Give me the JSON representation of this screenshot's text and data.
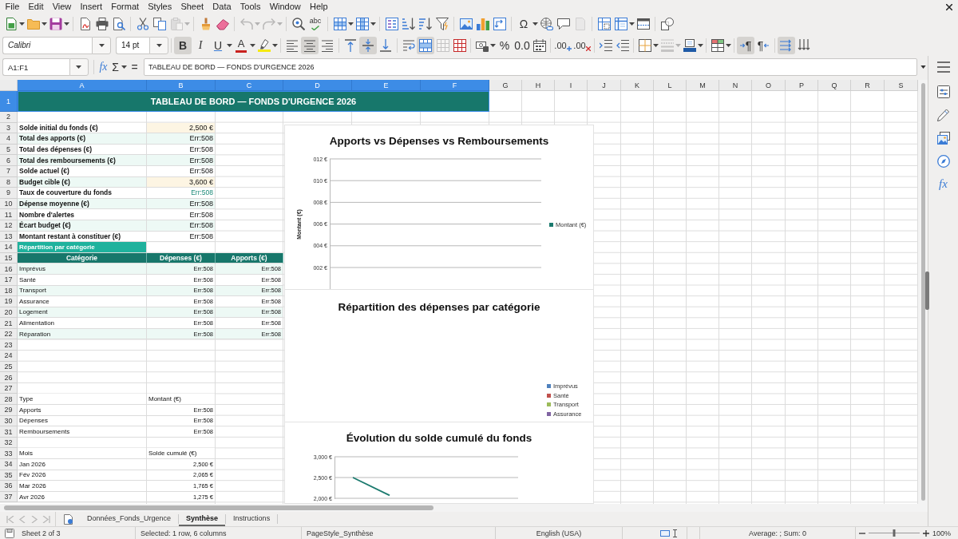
{
  "menu": [
    "File",
    "Edit",
    "View",
    "Insert",
    "Format",
    "Styles",
    "Sheet",
    "Data",
    "Tools",
    "Window",
    "Help"
  ],
  "standard_toolbar": {
    "paste_disabled": true,
    "undo_disabled": true,
    "redo_disabled": true,
    "header_footer_disabled": true,
    "spelling_glyph": "abc",
    "special_character_glyph": "Ω"
  },
  "formatting_toolbar": {
    "font_name": "Calibri",
    "font_size": "14 pt",
    "bold_glyph": "B",
    "bold": true,
    "italic_glyph": "I",
    "italic": false,
    "underline_glyph": "U",
    "underline": false,
    "font_color_glyph": "A",
    "align_left": false,
    "align_center": true,
    "align_right": false,
    "align_top": false,
    "align_middle": true,
    "align_bottom": false,
    "merge_and_center": true,
    "merge_disabled": true,
    "percent_glyph": "%",
    "number_glyph": "0.0",
    "add_decimal_glyph": ".00",
    "delete_decimal_glyph": ".00",
    "border_style_disabled": true,
    "paragraph_glyph_ltr": "¶",
    "paragraph_glyph_rtl": "¶",
    "left_to_right": true,
    "text_horizontal": true
  },
  "formula_bar": {
    "name_box": "A1:F1",
    "function_wizard_glyph": "fx",
    "sum_glyph": "Σ",
    "equals_glyph": "=",
    "content": "TABLEAU DE BORD — FONDS D'URGENCE 2026"
  },
  "sheet": {
    "columns": [
      {
        "label": "A",
        "selected": true
      },
      {
        "label": "B",
        "selected": true
      },
      {
        "label": "C",
        "selected": true
      },
      {
        "label": "D",
        "selected": true
      },
      {
        "label": "E",
        "selected": true
      },
      {
        "label": "F",
        "selected": true
      },
      {
        "label": "G",
        "selected": false
      },
      {
        "label": "H",
        "selected": false
      },
      {
        "label": "I",
        "selected": false
      },
      {
        "label": "J",
        "selected": false
      },
      {
        "label": "K",
        "selected": false
      },
      {
        "label": "L",
        "selected": false
      },
      {
        "label": "M",
        "selected": false
      },
      {
        "label": "N",
        "selected": false
      },
      {
        "label": "O",
        "selected": false
      },
      {
        "label": "P",
        "selected": false
      },
      {
        "label": "Q",
        "selected": false
      },
      {
        "label": "R",
        "selected": false
      },
      {
        "label": "S",
        "selected": false
      }
    ],
    "rows": [
      {
        "number": "1",
        "selected": true,
        "cells": [
          {
            "kind": "title",
            "text": "TABLEAU DE BORD — FONDS D'URGENCE 2026"
          }
        ]
      },
      {
        "number": "2",
        "selected": false
      },
      {
        "number": "3",
        "selected": false,
        "cells": [
          {
            "kind": "label",
            "text": "Solde initial du fonds (€)",
            "shaded": false
          },
          {
            "kind": "input",
            "text": "2,500 €"
          }
        ]
      },
      {
        "number": "4",
        "selected": false,
        "cells": [
          {
            "kind": "label",
            "text": "Total des apports (€)",
            "shaded": true
          },
          {
            "kind": "value",
            "text": "Err:508",
            "shaded": true
          }
        ]
      },
      {
        "number": "5",
        "selected": false,
        "cells": [
          {
            "kind": "label",
            "text": "Total des dépenses (€)",
            "shaded": false
          },
          {
            "kind": "value",
            "text": "Err:508",
            "shaded": false
          }
        ]
      },
      {
        "number": "6",
        "selected": false,
        "cells": [
          {
            "kind": "label",
            "text": "Total des remboursements (€)",
            "shaded": true
          },
          {
            "kind": "value",
            "text": "Err:508",
            "shaded": true
          }
        ]
      },
      {
        "number": "7",
        "selected": false,
        "cells": [
          {
            "kind": "label",
            "text": "Solde actuel (€)",
            "shaded": false
          },
          {
            "kind": "value",
            "text": "Err:508",
            "shaded": false
          }
        ]
      },
      {
        "number": "8",
        "selected": false,
        "cells": [
          {
            "kind": "label",
            "text": "Budget cible (€)",
            "shaded": true
          },
          {
            "kind": "input",
            "text": "3,600 €"
          }
        ]
      },
      {
        "number": "9",
        "selected": false,
        "cells": [
          {
            "kind": "label",
            "text": "Taux de couverture du fonds",
            "shaded": false
          },
          {
            "kind": "accent",
            "text": "Err:508",
            "shaded": false
          }
        ]
      },
      {
        "number": "10",
        "selected": false,
        "cells": [
          {
            "kind": "label",
            "text": "Dépense moyenne (€)",
            "shaded": true
          },
          {
            "kind": "value",
            "text": "Err:508",
            "shaded": true
          }
        ]
      },
      {
        "number": "11",
        "selected": false,
        "cells": [
          {
            "kind": "label",
            "text": "Nombre d'alertes",
            "shaded": false
          },
          {
            "kind": "value",
            "text": "Err:508",
            "shaded": false
          }
        ]
      },
      {
        "number": "12",
        "selected": false,
        "cells": [
          {
            "kind": "label",
            "text": "Écart budget (€)",
            "shaded": true
          },
          {
            "kind": "value",
            "text": "Err:508",
            "shaded": true
          }
        ]
      },
      {
        "number": "13",
        "selected": false,
        "cells": [
          {
            "kind": "label",
            "text": "Montant restant à constituer (€)",
            "shaded": false
          },
          {
            "kind": "value",
            "text": "Err:508",
            "shaded": false
          }
        ]
      },
      {
        "number": "14",
        "selected": false,
        "cells": [
          {
            "kind": "section",
            "text": "Répartition par catégorie"
          }
        ]
      },
      {
        "number": "15",
        "selected": false,
        "cells": [
          {
            "kind": "header",
            "text": "Catégorie"
          },
          {
            "kind": "header",
            "text": "Dépenses (€)"
          },
          {
            "kind": "header",
            "text": "Apports (€)"
          }
        ]
      },
      {
        "number": "16",
        "selected": false,
        "cells": [
          {
            "kind": "text",
            "text": "Imprévus",
            "shaded": true
          },
          {
            "kind": "number",
            "text": "Err:508",
            "shaded": true
          },
          {
            "kind": "number",
            "text": "Err:508",
            "shaded": true
          }
        ]
      },
      {
        "number": "17",
        "selected": false,
        "cells": [
          {
            "kind": "text",
            "text": "Santé",
            "shaded": false
          },
          {
            "kind": "number",
            "text": "Err:508",
            "shaded": false
          },
          {
            "kind": "number",
            "text": "Err:508",
            "shaded": false
          }
        ]
      },
      {
        "number": "18",
        "selected": false,
        "cells": [
          {
            "kind": "text",
            "text": "Transport",
            "shaded": true
          },
          {
            "kind": "number",
            "text": "Err:508",
            "shaded": true
          },
          {
            "kind": "number",
            "text": "Err:508",
            "shaded": true
          }
        ]
      },
      {
        "number": "19",
        "selected": false,
        "cells": [
          {
            "kind": "text",
            "text": "Assurance",
            "shaded": false
          },
          {
            "kind": "number",
            "text": "Err:508",
            "shaded": false
          },
          {
            "kind": "number",
            "text": "Err:508",
            "shaded": false
          }
        ]
      },
      {
        "number": "20",
        "selected": false,
        "cells": [
          {
            "kind": "text",
            "text": "Logement",
            "shaded": true
          },
          {
            "kind": "number",
            "text": "Err:508",
            "shaded": true
          },
          {
            "kind": "number",
            "text": "Err:508",
            "shaded": true
          }
        ]
      },
      {
        "number": "21",
        "selected": false,
        "cells": [
          {
            "kind": "text",
            "text": "Alimentation",
            "shaded": false
          },
          {
            "kind": "number",
            "text": "Err:508",
            "shaded": false
          },
          {
            "kind": "number",
            "text": "Err:508",
            "shaded": false
          }
        ]
      },
      {
        "number": "22",
        "selected": false,
        "cells": [
          {
            "kind": "text",
            "text": "Réparation",
            "shaded": true
          },
          {
            "kind": "number",
            "text": "Err:508",
            "shaded": true
          },
          {
            "kind": "number",
            "text": "Err:508",
            "shaded": true
          }
        ]
      },
      {
        "number": "23",
        "selected": false
      },
      {
        "number": "24",
        "selected": false
      },
      {
        "number": "25",
        "selected": false
      },
      {
        "number": "26",
        "selected": false
      },
      {
        "number": "27",
        "selected": false
      },
      {
        "number": "28",
        "selected": false,
        "cells": [
          {
            "kind": "text",
            "text": "Type",
            "shaded": false
          },
          {
            "kind": "text",
            "text": "Montant (€)",
            "shaded": false
          }
        ]
      },
      {
        "number": "29",
        "selected": false,
        "cells": [
          {
            "kind": "text",
            "text": "Apports",
            "shaded": false
          },
          {
            "kind": "number",
            "text": "Err:508",
            "shaded": false
          }
        ]
      },
      {
        "number": "30",
        "selected": false,
        "cells": [
          {
            "kind": "text",
            "text": "Dépenses",
            "shaded": false
          },
          {
            "kind": "number",
            "text": "Err:508",
            "shaded": false
          }
        ]
      },
      {
        "number": "31",
        "selected": false,
        "cells": [
          {
            "kind": "text",
            "text": "Remboursements",
            "shaded": false
          },
          {
            "kind": "number",
            "text": "Err:508",
            "shaded": false
          }
        ]
      },
      {
        "number": "32",
        "selected": false
      },
      {
        "number": "33",
        "selected": false,
        "cells": [
          {
            "kind": "text",
            "text": "Mois",
            "shaded": false
          },
          {
            "kind": "text",
            "text": "Solde cumulé (€)",
            "shaded": false
          }
        ]
      },
      {
        "number": "34",
        "selected": false,
        "cells": [
          {
            "kind": "text",
            "text": "Jan 2026",
            "shaded": false
          },
          {
            "kind": "number",
            "text": "2,500 €",
            "shaded": false
          }
        ]
      },
      {
        "number": "35",
        "selected": false,
        "cells": [
          {
            "kind": "text",
            "text": "Fév 2026",
            "shaded": false
          },
          {
            "kind": "number",
            "text": "2,065 €",
            "shaded": false
          }
        ]
      },
      {
        "number": "36",
        "selected": false,
        "cells": [
          {
            "kind": "text",
            "text": "Mar 2026",
            "shaded": false
          },
          {
            "kind": "number",
            "text": "1,765 €",
            "shaded": false
          }
        ]
      },
      {
        "number": "37",
        "selected": false,
        "cells": [
          {
            "kind": "text",
            "text": "Avr 2026",
            "shaded": false
          },
          {
            "kind": "number",
            "text": "1,275 €",
            "shaded": false
          }
        ]
      }
    ]
  },
  "charts": [
    {
      "kind": "axes",
      "chart_data": {
        "type": "bar",
        "title": "Apports vs Dépenses vs Remboursements",
        "ylabel": "Montant (€)",
        "ylim": [
          0,
          12
        ],
        "grid": true,
        "yticks": [
          {
            "value": 12,
            "label": "012 €"
          },
          {
            "value": 10,
            "label": "010 €"
          },
          {
            "value": 8,
            "label": "008 €"
          },
          {
            "value": 6,
            "label": "006 €"
          },
          {
            "value": 4,
            "label": "004 €"
          },
          {
            "value": 2,
            "label": "002 €"
          }
        ],
        "series": [
          {
            "name": "Montant (€)",
            "color": "#1b7a6e"
          }
        ]
      }
    },
    {
      "kind": "pie",
      "title": "Répartition des dépenses par catégorie",
      "legend": [
        {
          "label": "Imprévus",
          "color": "#4f81bd"
        },
        {
          "label": "Santé",
          "color": "#c0504d"
        },
        {
          "label": "Transport",
          "color": "#9bbb59"
        },
        {
          "label": "Assurance",
          "color": "#8064a2"
        }
      ]
    },
    {
      "kind": "axes",
      "chart_data": {
        "type": "line",
        "title": "Évolution du solde cumulé du fonds",
        "categories": [
          null,
          null,
          null,
          null,
          null
        ],
        "ylim": [
          2000,
          3000
        ],
        "grid": true,
        "yticks": [
          {
            "value": 3000,
            "label": "3,000 €"
          },
          {
            "value": 2500,
            "label": "2,500 €"
          },
          {
            "value": 2000,
            "label": "2,000 €"
          }
        ],
        "series": [
          {
            "color": "#1b7a6e",
            "values": [
              2500,
              2070,
              null,
              null,
              null
            ]
          }
        ]
      }
    }
  ],
  "sheet_tabs": {
    "navigation_disabled": true,
    "tabs": [
      {
        "label": "Données_Fonds_Urgence",
        "selected": false
      },
      {
        "label": "Synthèse",
        "selected": true
      },
      {
        "label": "Instructions",
        "selected": false
      }
    ]
  },
  "sidebar": {
    "functions_glyph": "fx"
  },
  "status_bar": {
    "sheet": "Sheet 2 of 3",
    "selection": "Selected: 1 row, 6 columns",
    "page_style": "PageStyle_Synthèse",
    "language": "English (USA)",
    "summary": "Average: ; Sum: 0",
    "zoom_slider": {
      "level": 0.5
    },
    "zoom": "100%"
  }
}
